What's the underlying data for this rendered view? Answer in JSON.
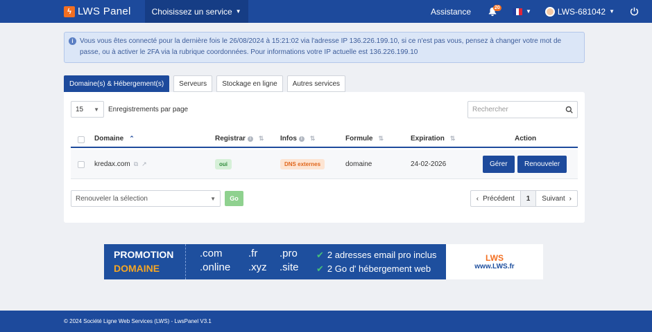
{
  "header": {
    "logo_text": "LWS Panel",
    "service_menu": "Choisissez un service",
    "assistance": "Assistance",
    "notif_count": "20",
    "user": "LWS-681042"
  },
  "alert": {
    "text": "Vous vous êtes connecté pour la dernière fois le 26/08/2024 à 15:21:02 via l'adresse IP 136.226.199.10, si ce n'est pas vous, pensez à changer votre mot de passe, ou à activer le 2FA via la rubrique coordonnées. Pour informations votre IP actuelle est 136.226.199.10"
  },
  "tabs": [
    {
      "label": "Domaine(s) & Hébergement(s)"
    },
    {
      "label": "Serveurs"
    },
    {
      "label": "Stockage en ligne"
    },
    {
      "label": "Autres services"
    }
  ],
  "table": {
    "per_page_value": "15",
    "per_page_label": "Enregistrements par page",
    "search_placeholder": "Rechercher",
    "columns": {
      "domain": "Domaine",
      "registrar": "Registrar",
      "infos": "Infos",
      "formule": "Formule",
      "expiration": "Expiration",
      "action": "Action"
    },
    "rows": [
      {
        "domain": "kredax.com",
        "registrar": "oui",
        "infos": "DNS externes",
        "formule": "domaine",
        "expiration": "24-02-2026",
        "manage": "Gérer",
        "renew": "Renouveler"
      }
    ],
    "bulk_placeholder": "Renouveler la sélection",
    "go": "Go",
    "prev": "Précédent",
    "page": "1",
    "next": "Suivant"
  },
  "promo": {
    "line1": "PROMOTION",
    "line2": "DOMAINE",
    "tlds": [
      ".com",
      ".fr",
      ".pro",
      ".online",
      ".xyz",
      ".site"
    ],
    "feature1": "2 adresses email pro inclus",
    "feature2": "2 Go d' hébergement web",
    "logo": "LWS",
    "url": "www.LWS.fr"
  },
  "footer": {
    "text": "© 2024 Société Ligne Web Services (LWS) - LwsPanel V3.1"
  },
  "colors": {
    "primary": "#1d4a9c",
    "accent": "#f36f21"
  }
}
